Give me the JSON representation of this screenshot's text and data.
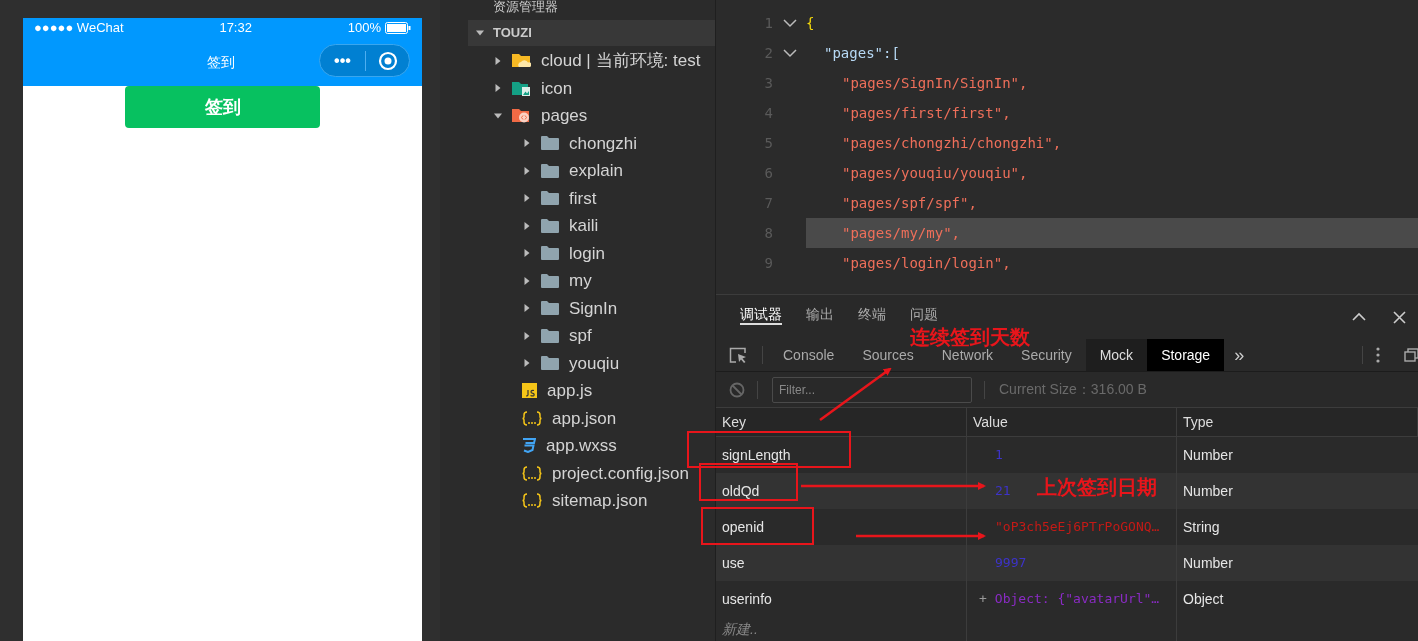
{
  "phone": {
    "carrier": "●●●●● WeChat",
    "time": "17:32",
    "battery_text": "100%",
    "nav_title": "签到",
    "menu_dots": "•••",
    "button": "签到"
  },
  "explorer": {
    "title": "资源管理器",
    "project": "TOUZI",
    "project_expanded": true,
    "tree": [
      {
        "label": "cloud | 当前环境: test",
        "kind": "cloud-folder",
        "expanded": false
      },
      {
        "label": "icon",
        "kind": "image-folder",
        "expanded": false
      },
      {
        "label": "pages",
        "kind": "code-folder",
        "expanded": true,
        "children": [
          {
            "label": "chongzhi",
            "kind": "folder",
            "expanded": false
          },
          {
            "label": "explain",
            "kind": "folder",
            "expanded": false
          },
          {
            "label": "first",
            "kind": "folder",
            "expanded": false
          },
          {
            "label": "kaili",
            "kind": "folder",
            "expanded": false
          },
          {
            "label": "login",
            "kind": "folder",
            "expanded": false
          },
          {
            "label": "my",
            "kind": "folder",
            "expanded": false
          },
          {
            "label": "SignIn",
            "kind": "folder",
            "expanded": false
          },
          {
            "label": "spf",
            "kind": "folder",
            "expanded": false
          },
          {
            "label": "youqiu",
            "kind": "folder",
            "expanded": false
          }
        ]
      },
      {
        "label": "app.js",
        "kind": "js"
      },
      {
        "label": "app.json",
        "kind": "json"
      },
      {
        "label": "app.wxss",
        "kind": "wxss"
      },
      {
        "label": "project.config.json",
        "kind": "json"
      },
      {
        "label": "sitemap.json",
        "kind": "json"
      }
    ]
  },
  "editor": {
    "lines": [
      {
        "number": "1",
        "text": "{",
        "kind": "brace",
        "foldable": true,
        "selected": false
      },
      {
        "number": "2",
        "text": "\"pages\":[",
        "kind": "key",
        "foldable": true,
        "selected": false
      },
      {
        "number": "3",
        "text": "\"pages/SignIn/SignIn\",",
        "kind": "string",
        "foldable": false,
        "selected": false
      },
      {
        "number": "4",
        "text": "\"pages/first/first\",",
        "kind": "string",
        "foldable": false,
        "selected": false
      },
      {
        "number": "5",
        "text": "\"pages/chongzhi/chongzhi\",",
        "kind": "string",
        "foldable": false,
        "selected": false
      },
      {
        "number": "6",
        "text": "\"pages/youqiu/youqiu\",",
        "kind": "string",
        "foldable": false,
        "selected": false
      },
      {
        "number": "7",
        "text": "\"pages/spf/spf\",",
        "kind": "string",
        "foldable": false,
        "selected": false
      },
      {
        "number": "8",
        "text": "\"pages/my/my\",",
        "kind": "string",
        "foldable": false,
        "selected": true
      },
      {
        "number": "9",
        "text": "\"pages/login/login\",",
        "kind": "string",
        "foldable": false,
        "selected": false
      }
    ]
  },
  "devtools": {
    "panel_tabs": [
      {
        "label": "调试器",
        "selected": true
      },
      {
        "label": "输出",
        "selected": false
      },
      {
        "label": "终端",
        "selected": false
      },
      {
        "label": "问题",
        "selected": false
      }
    ],
    "tool_tabs": [
      {
        "label": "Console",
        "selected": false,
        "highlighted": false
      },
      {
        "label": "Sources",
        "selected": false,
        "highlighted": false
      },
      {
        "label": "Network",
        "selected": false,
        "highlighted": false
      },
      {
        "label": "Security",
        "selected": false,
        "highlighted": false
      },
      {
        "label": "Mock",
        "selected": false,
        "highlighted": true
      },
      {
        "label": "Storage",
        "selected": true,
        "highlighted": false
      }
    ],
    "more": "»",
    "filter": {
      "placeholder": "Filter..."
    },
    "current_size": "Current Size：316.00 B",
    "table": {
      "columns": [
        "Key",
        "Value",
        "Type"
      ],
      "rows": [
        {
          "key": "signLength",
          "value": "1",
          "kind": "number",
          "type": "Number"
        },
        {
          "key": "oldQd",
          "value": "21",
          "kind": "number",
          "type": "Number"
        },
        {
          "key": "openid",
          "value": "\"oP3ch5eEj6PTrPoGONQ…",
          "kind": "string",
          "type": "String"
        },
        {
          "key": "use",
          "value": "9997",
          "kind": "number",
          "type": "Number"
        },
        {
          "key": "userinfo",
          "value": "Object: {\"avatarUrl\"…",
          "kind": "object",
          "expander": "+",
          "type": "Object"
        }
      ],
      "new_row": "新建.."
    }
  },
  "annotations": [
    {
      "kind": "label",
      "text": "连续签到天数"
    },
    {
      "kind": "label",
      "text": "上次签到日期"
    }
  ]
}
